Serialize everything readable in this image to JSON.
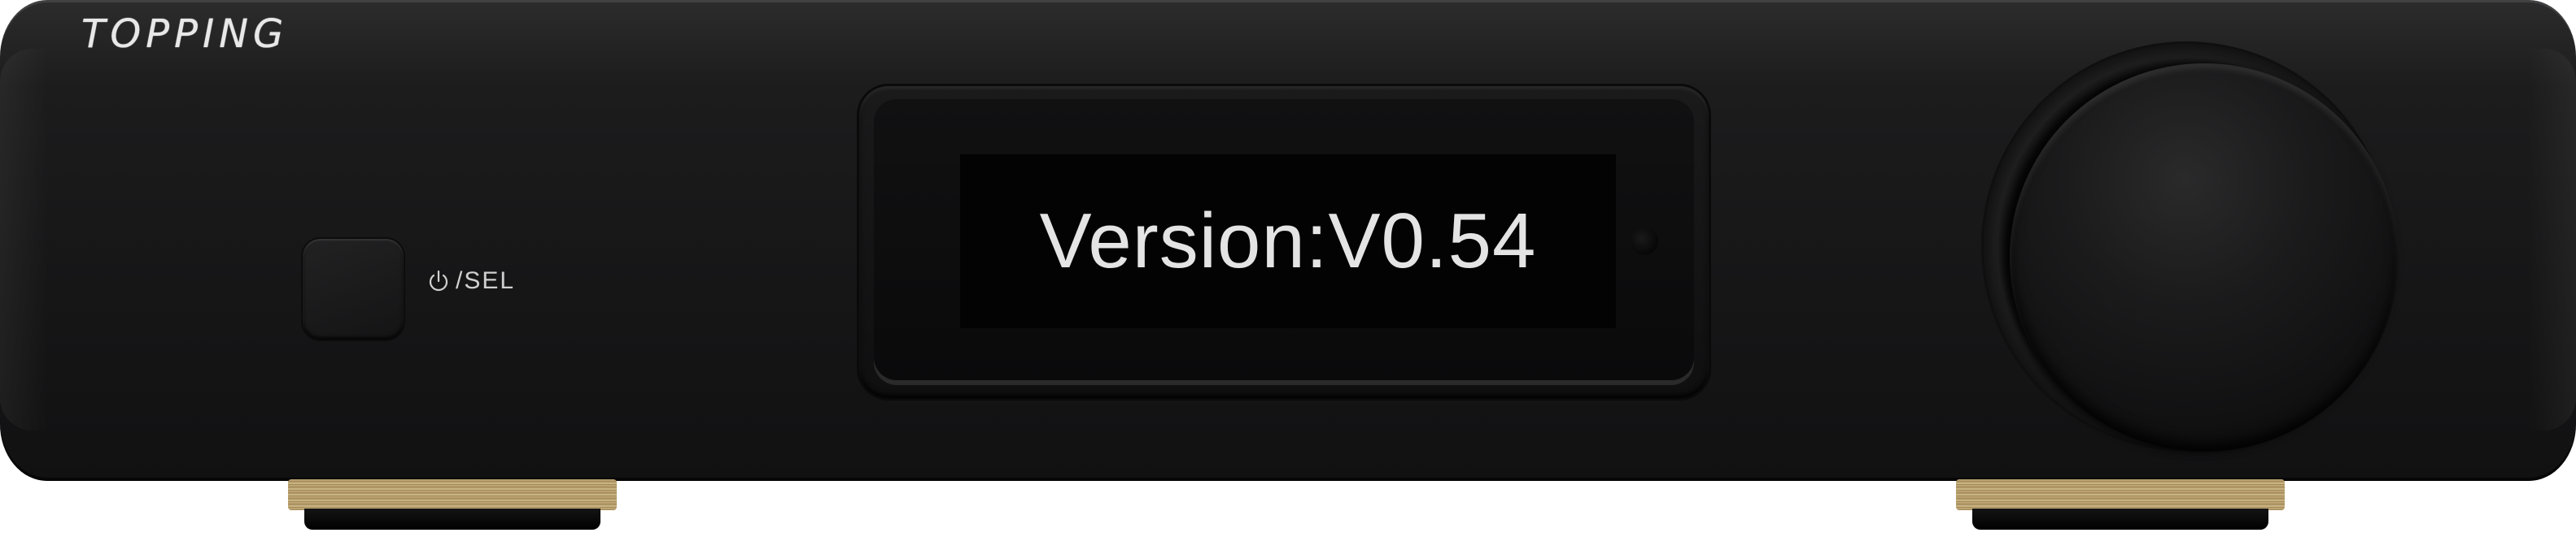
{
  "brand": {
    "logo_text": "TOPPING"
  },
  "controls": {
    "power_label": "/SEL",
    "power_icon": "power-icon"
  },
  "display": {
    "text": "Version:V0.54"
  },
  "colors": {
    "body": "#161617",
    "display_text": "#e4e4e4",
    "foot_brass": "#c8b07c"
  }
}
